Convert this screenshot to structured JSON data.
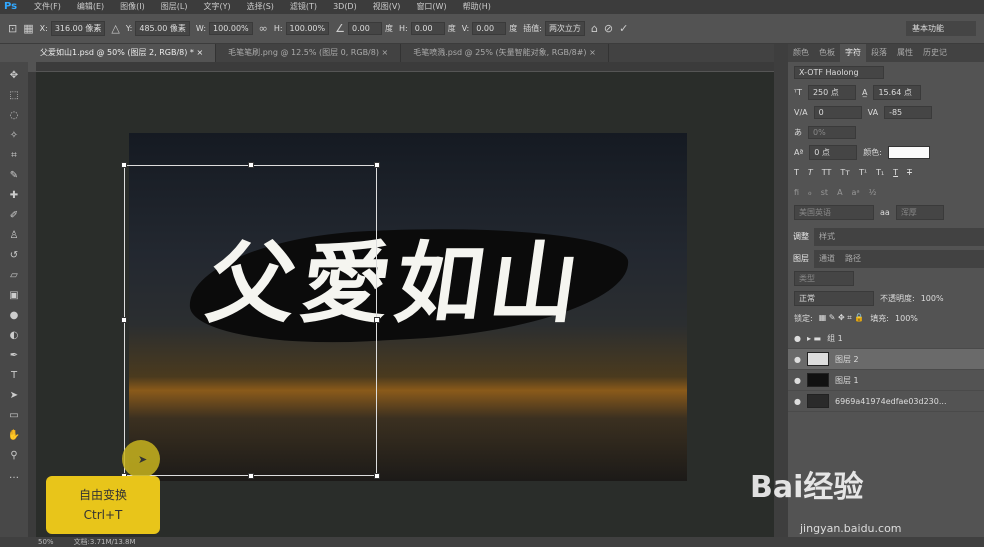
{
  "app": {
    "logo": "Ps"
  },
  "menu": [
    "文件(F)",
    "编辑(E)",
    "图像(I)",
    "图层(L)",
    "文字(Y)",
    "选择(S)",
    "滤镜(T)",
    "3D(D)",
    "视图(V)",
    "窗口(W)",
    "帮助(H)"
  ],
  "options": {
    "x_label": "X:",
    "x_value": "316.00 像素",
    "y_label": "Y:",
    "y_value": "485.00 像素",
    "w_label": "W:",
    "w_value": "100.00%",
    "h_label": "H:",
    "h_value": "100.00%",
    "angle_value": "0.00",
    "angle_unit": "度",
    "hskew_label": "H:",
    "hskew_value": "0.00",
    "hskew_unit": "度",
    "vskew_label": "V:",
    "vskew_value": "0.00",
    "vskew_unit": "度",
    "interp_label": "插值:",
    "interp_value": "两次立方",
    "workspace": "基本功能"
  },
  "tabs": [
    {
      "label": "父爱如山1.psd @ 50% (图层 2, RGB/8) *",
      "close": "×"
    },
    {
      "label": "毛笔笔刷.png @ 12.5% (图层 0, RGB/8)",
      "close": "×"
    },
    {
      "label": "毛笔喷溅.psd @ 25% (矢量智能对象, RGB/8#)",
      "close": "×"
    }
  ],
  "canvas": {
    "headline": "父愛如山"
  },
  "hint": {
    "title": "自由变换",
    "shortcut": "Ctrl+T"
  },
  "status": {
    "zoom": "50%",
    "doc": "文档:3.71M/13.8M"
  },
  "char_panel": {
    "tabs": [
      "颜色",
      "色板",
      "字符",
      "段落",
      "属性",
      "历史记"
    ],
    "font": "X-OTF Haolong",
    "size": "250 点",
    "leading": "15.64 点",
    "kerning": "0",
    "tracking": "-85",
    "vscale": "0%",
    "baseline": "0 点",
    "color_label": "颜色:",
    "lang": "美国英语",
    "aa": "浑厚"
  },
  "adjust_tabs": [
    "调整",
    "样式"
  ],
  "layers_panel": {
    "tabs": [
      "图层",
      "通道",
      "路径"
    ],
    "kind": "类型",
    "blend": "正常",
    "opacity_label": "不透明度:",
    "opacity": "100%",
    "lock_label": "锁定:",
    "fill_label": "填充:",
    "fill": "100%",
    "layers": [
      {
        "name": "组 1"
      },
      {
        "name": "图层 2"
      },
      {
        "name": "图层 1"
      },
      {
        "name": "6969a41974edfae03d230..."
      }
    ]
  },
  "watermark": {
    "brand": "Bai经验",
    "url": "jingyan.baidu.com"
  }
}
